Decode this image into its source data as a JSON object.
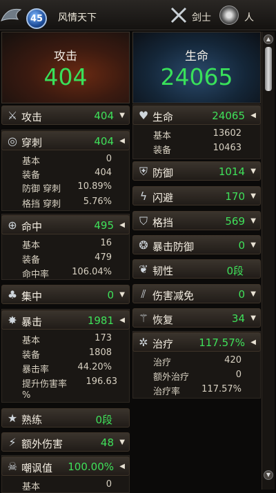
{
  "header": {
    "level": "45",
    "player_name": "风情天下",
    "class_name": "剑士",
    "race_name": "人"
  },
  "attack_panel": {
    "label": "攻击",
    "value": "404"
  },
  "life_panel": {
    "label": "生命",
    "value": "24065"
  },
  "left_column": [
    {
      "key": "attack",
      "icon": "crossed-swords-icon",
      "label": "攻击",
      "value": "404",
      "arrow": "▼"
    },
    {
      "key": "pierce",
      "icon": "pierce-icon",
      "label": "穿刺",
      "value": "404",
      "arrow": "◀",
      "details": [
        {
          "k": "基本",
          "v": "0"
        },
        {
          "k": "装备",
          "v": "404"
        },
        {
          "k": "防御 穿刺",
          "v": "10.89%"
        },
        {
          "k": "格挡 穿刺",
          "v": "5.76%"
        }
      ]
    },
    {
      "key": "accuracy",
      "icon": "crosshair-icon",
      "label": "命中",
      "value": "495",
      "arrow": "◀",
      "details": [
        {
          "k": "基本",
          "v": "16"
        },
        {
          "k": "装备",
          "v": "479"
        },
        {
          "k": "命中率",
          "v": "106.04%"
        }
      ]
    },
    {
      "key": "focus",
      "icon": "focus-icon",
      "label": "集中",
      "value": "0",
      "arrow": "▼"
    },
    {
      "key": "critical",
      "icon": "burst-icon",
      "label": "暴击",
      "value": "1981",
      "arrow": "◀",
      "details": [
        {
          "k": "基本",
          "v": "173"
        },
        {
          "k": "装备",
          "v": "1808"
        },
        {
          "k": "暴击率",
          "v": "44.20%"
        }
      ],
      "extra_line1_k": "提升伤害率",
      "extra_line1_v": "196.63",
      "extra_line2": "%"
    },
    {
      "key": "mastery",
      "icon": "mastery-icon",
      "label": "熟练",
      "value": "0段",
      "arrow": ""
    },
    {
      "key": "extra_damage",
      "icon": "lightning-slash-icon",
      "label": "额外伤害",
      "value": "48",
      "arrow": "▼"
    },
    {
      "key": "threat",
      "icon": "skull-icon",
      "label": "嘲讽值",
      "value": "100.00%",
      "arrow": "◀",
      "details": [
        {
          "k": "基本",
          "v": "0"
        }
      ]
    }
  ],
  "right_column": [
    {
      "key": "life",
      "icon": "heart-icon",
      "label": "生命",
      "value": "24065",
      "arrow": "◀",
      "details": [
        {
          "k": "基本",
          "v": "13602"
        },
        {
          "k": "装备",
          "v": "10463"
        }
      ]
    },
    {
      "key": "defense",
      "icon": "shield-icon",
      "label": "防御",
      "value": "1014",
      "arrow": "▼"
    },
    {
      "key": "evasion",
      "icon": "dodge-icon",
      "label": "闪避",
      "value": "170",
      "arrow": "▼"
    },
    {
      "key": "block",
      "icon": "block-shield-icon",
      "label": "格挡",
      "value": "569",
      "arrow": "▼"
    },
    {
      "key": "crit_defense",
      "icon": "crit-defense-icon",
      "label": "暴击防御",
      "value": "0",
      "arrow": "▼"
    },
    {
      "key": "tenacity",
      "icon": "tenacity-icon",
      "label": "韧性",
      "value": "0段",
      "arrow": ""
    },
    {
      "key": "damage_reduction",
      "icon": "damage-reduction-icon",
      "label": "伤害减免",
      "value": "0",
      "arrow": "▼"
    },
    {
      "key": "recovery",
      "icon": "recovery-icon",
      "label": "恢复",
      "value": "34",
      "arrow": "▼"
    },
    {
      "key": "healing",
      "icon": "healing-icon",
      "label": "治疗",
      "value": "117.57%",
      "arrow": "◀",
      "details": [
        {
          "k": "治疗",
          "v": "420"
        },
        {
          "k": "额外治疗",
          "v": "0"
        },
        {
          "k": "治疗率",
          "v": "117.57%"
        }
      ]
    }
  ]
}
